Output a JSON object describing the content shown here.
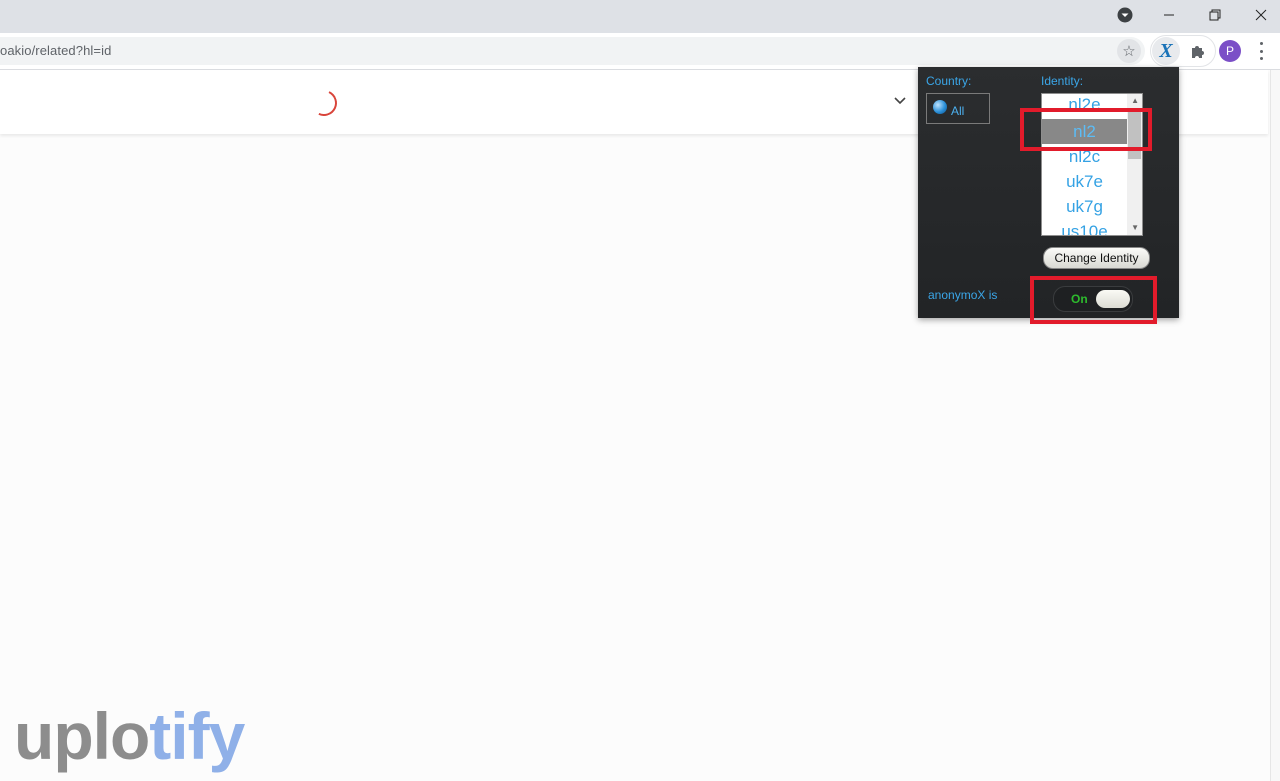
{
  "browser": {
    "url_fragment": "oakio/related?hl=id",
    "profile_initial": "P",
    "window_controls": [
      "minimize",
      "restore",
      "close"
    ]
  },
  "popup": {
    "country_label": "Country:",
    "country_value": "All",
    "identity_label": "Identity:",
    "identities": [
      "nl2e",
      "nl2",
      "nl2c",
      "uk7e",
      "uk7g",
      "us10e"
    ],
    "selected_identity": "nl2",
    "change_button": "Change Identity",
    "status_label": "anonymoX is",
    "toggle_state": "On"
  },
  "colors": {
    "accent_blue": "#3aa6e8",
    "highlight_red": "#e21b2b",
    "toggle_green": "#2dbb2d"
  },
  "watermark": {
    "part1": "uplo",
    "part2": "tify"
  }
}
